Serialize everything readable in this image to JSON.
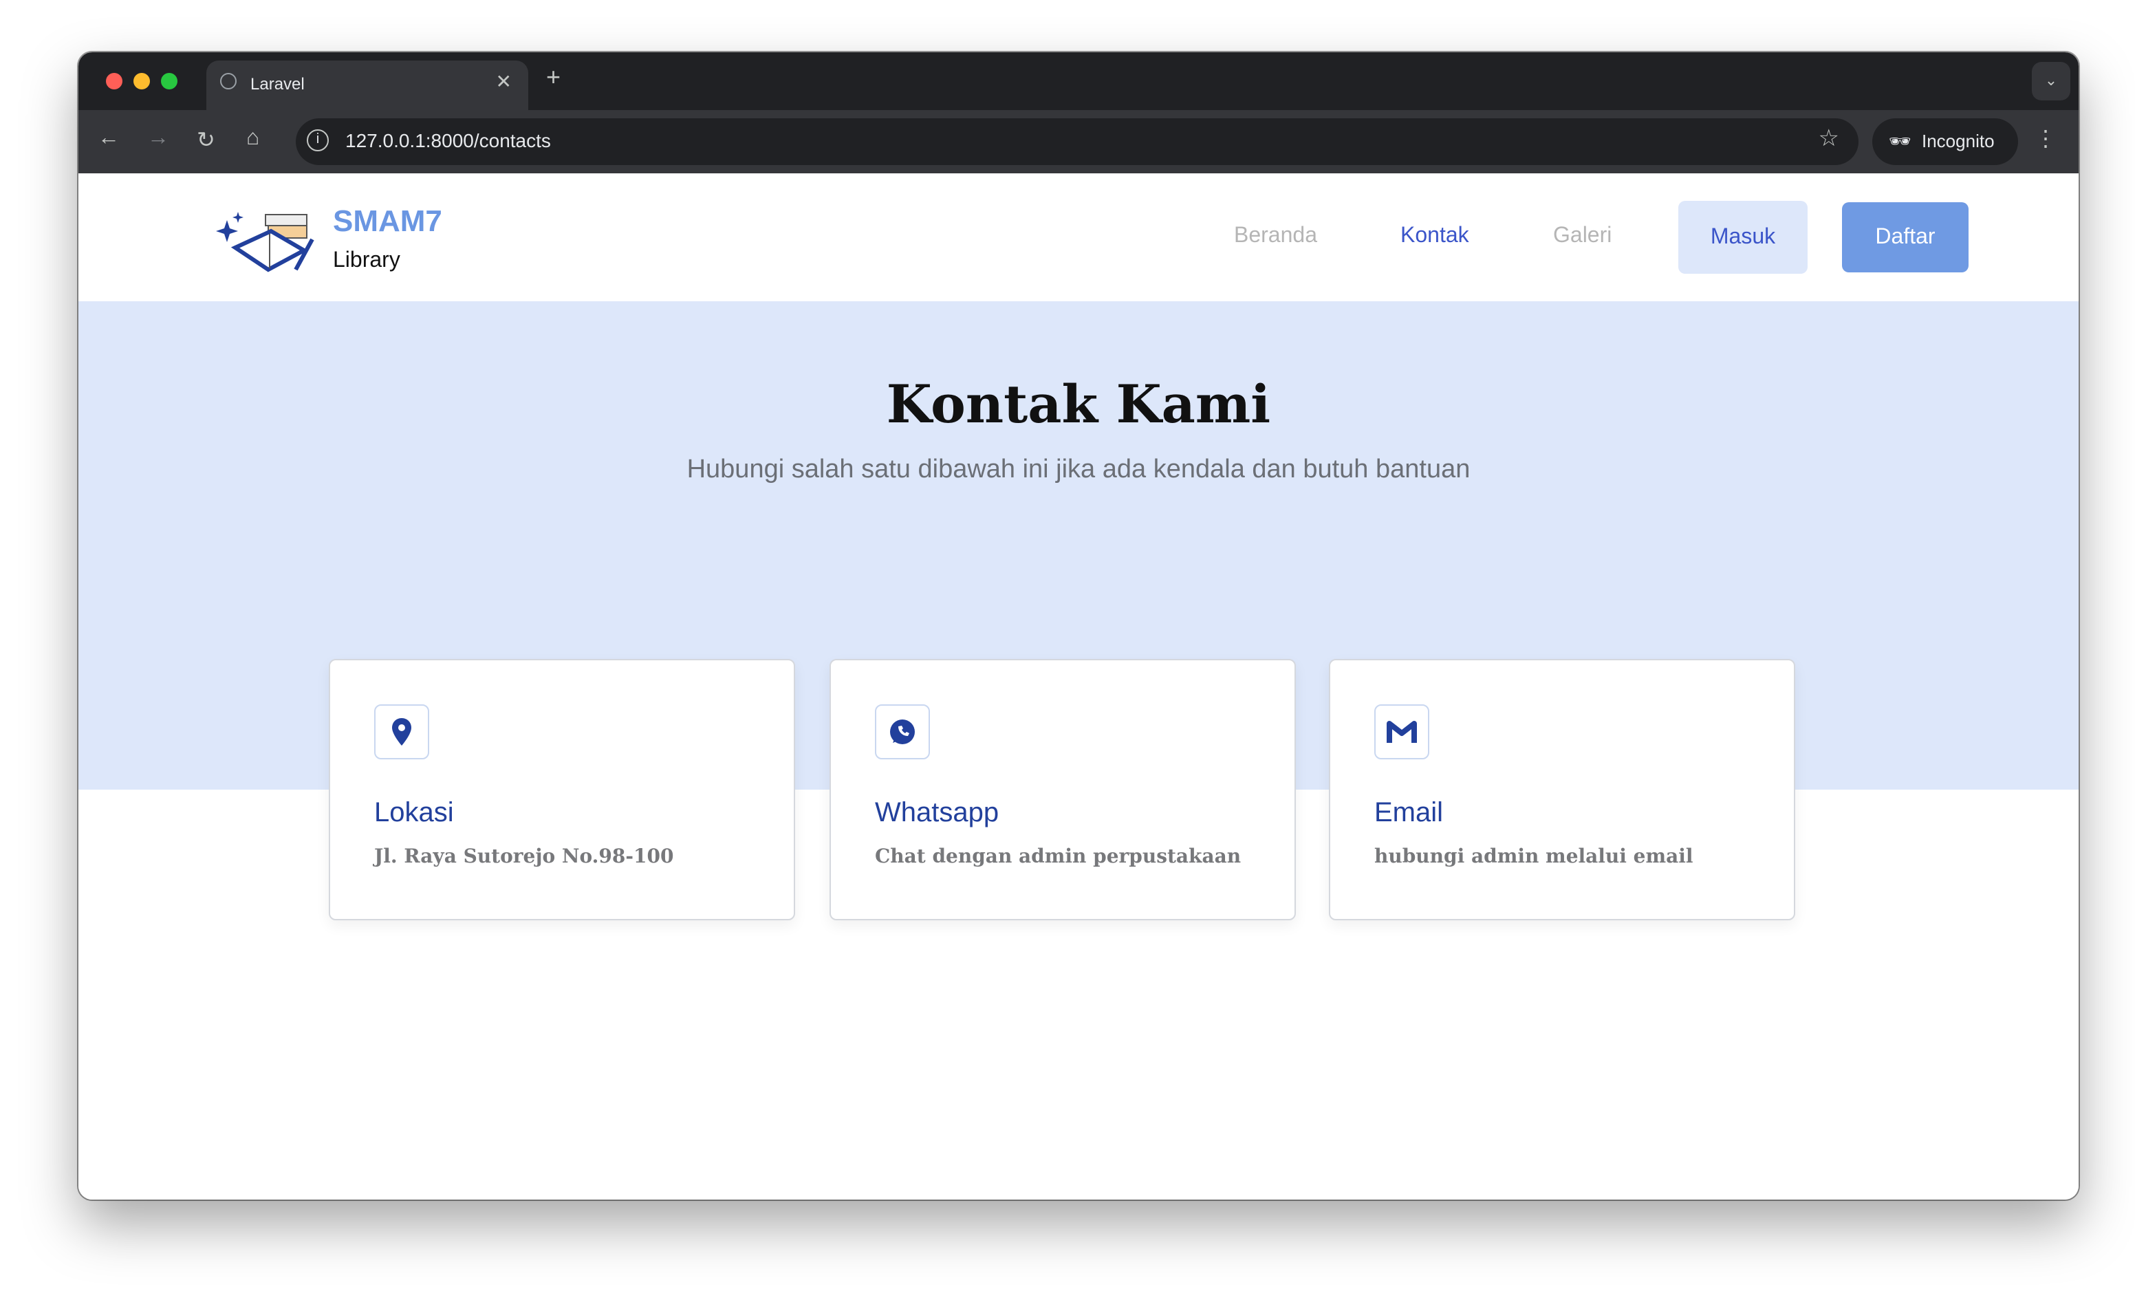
{
  "browser": {
    "tab_title": "Laravel",
    "url": "127.0.0.1:8000/contacts",
    "incognito_label": "Incognito"
  },
  "brand": {
    "name": "SMAM7",
    "subtitle": "Library"
  },
  "nav": {
    "items": [
      "Beranda",
      "Kontak",
      "Galeri"
    ],
    "active": "Kontak",
    "login": "Masuk",
    "register": "Daftar"
  },
  "hero": {
    "title": "Kontak Kami",
    "subtitle": "Hubungi salah satu dibawah ini jika ada kendala dan butuh bantuan"
  },
  "cards": [
    {
      "icon": "map-pin-icon",
      "title": "Lokasi",
      "desc": "Jl. Raya Sutorejo No.98-100"
    },
    {
      "icon": "whatsapp-icon",
      "title": "Whatsapp",
      "desc": "Chat dengan admin perpustakaan"
    },
    {
      "icon": "gmail-icon",
      "title": "Email",
      "desc": "hubungi admin melalui email"
    }
  ],
  "colors": {
    "accent": "#22409c",
    "brand": "#6a96e2",
    "hero_bg": "#dde7fa"
  }
}
